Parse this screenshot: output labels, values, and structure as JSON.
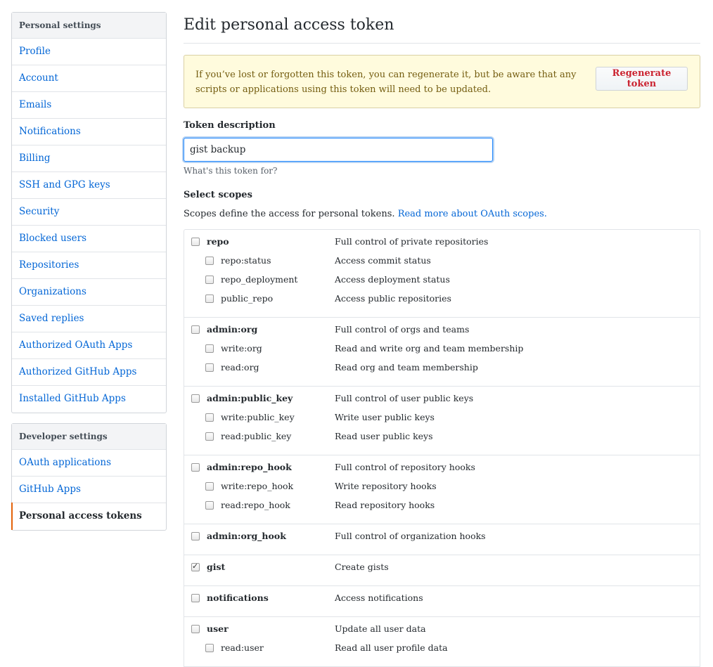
{
  "sidebar": {
    "personal_heading": "Personal settings",
    "personal_items": [
      "Profile",
      "Account",
      "Emails",
      "Notifications",
      "Billing",
      "SSH and GPG keys",
      "Security",
      "Blocked users",
      "Repositories",
      "Organizations",
      "Saved replies",
      "Authorized OAuth Apps",
      "Authorized GitHub Apps",
      "Installed GitHub Apps"
    ],
    "developer_heading": "Developer settings",
    "developer_items": [
      "OAuth applications",
      "GitHub Apps",
      "Personal access tokens"
    ],
    "selected": "Personal access tokens"
  },
  "main": {
    "title": "Edit personal access token",
    "flash": {
      "text": "If you’ve lost or forgotten this token, you can regenerate it, but be aware that any scripts or applications using this token will need to be updated.",
      "button": "Regenerate token"
    },
    "token_description": {
      "label": "Token description",
      "value": "gist backup",
      "note": "What's this token for?"
    },
    "scopes": {
      "heading": "Select scopes",
      "intro": "Scopes define the access for personal tokens.",
      "link": "Read more about OAuth scopes.",
      "groups": [
        {
          "name": "repo",
          "desc": "Full control of private repositories",
          "checked": false,
          "children": [
            {
              "name": "repo:status",
              "desc": "Access commit status",
              "checked": false
            },
            {
              "name": "repo_deployment",
              "desc": "Access deployment status",
              "checked": false
            },
            {
              "name": "public_repo",
              "desc": "Access public repositories",
              "checked": false
            }
          ]
        },
        {
          "name": "admin:org",
          "desc": "Full control of orgs and teams",
          "checked": false,
          "children": [
            {
              "name": "write:org",
              "desc": "Read and write org and team membership",
              "checked": false
            },
            {
              "name": "read:org",
              "desc": "Read org and team membership",
              "checked": false
            }
          ]
        },
        {
          "name": "admin:public_key",
          "desc": "Full control of user public keys",
          "checked": false,
          "children": [
            {
              "name": "write:public_key",
              "desc": "Write user public keys",
              "checked": false
            },
            {
              "name": "read:public_key",
              "desc": "Read user public keys",
              "checked": false
            }
          ]
        },
        {
          "name": "admin:repo_hook",
          "desc": "Full control of repository hooks",
          "checked": false,
          "children": [
            {
              "name": "write:repo_hook",
              "desc": "Write repository hooks",
              "checked": false
            },
            {
              "name": "read:repo_hook",
              "desc": "Read repository hooks",
              "checked": false
            }
          ]
        },
        {
          "name": "admin:org_hook",
          "desc": "Full control of organization hooks",
          "checked": false,
          "children": []
        },
        {
          "name": "gist",
          "desc": "Create gists",
          "checked": true,
          "children": []
        },
        {
          "name": "notifications",
          "desc": "Access notifications",
          "checked": false,
          "children": []
        },
        {
          "name": "user",
          "desc": "Update all user data",
          "checked": false,
          "children": [
            {
              "name": "read:user",
              "desc": "Read all user profile data",
              "checked": false
            }
          ]
        }
      ]
    }
  }
}
